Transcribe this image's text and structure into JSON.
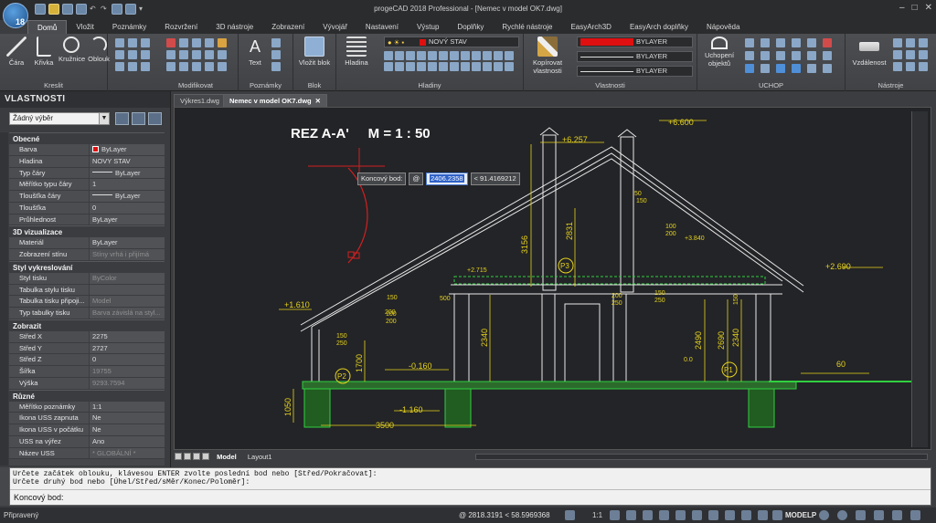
{
  "app": {
    "title": "progeCAD 2018 Professional - [Nemec v model OK7.dwg]",
    "logo_badge": "18"
  },
  "menu_tabs": [
    "Domů",
    "Vložit",
    "Poznámky",
    "Rozvržení",
    "3D nástroje",
    "Zobrazení",
    "Vývojář",
    "Nastavení",
    "Výstup",
    "Doplňky",
    "Rychlé nástroje",
    "EasyArch3D",
    "EasyArch doplňky",
    "Nápověda"
  ],
  "ribbon": {
    "draw": {
      "group": "Kreslit",
      "buttons": [
        "Čára",
        "Křivka",
        "Kružnice",
        "Oblouk"
      ]
    },
    "modify": {
      "group": "Modifikovat"
    },
    "annotation": {
      "group": "Poznámky",
      "buttons": [
        "Text"
      ]
    },
    "block": {
      "group": "Blok",
      "buttons": [
        "Vložit blok"
      ]
    },
    "layers": {
      "group": "Hladiny",
      "buttons": [
        "Hladina"
      ],
      "current_layer": "NOVÝ STAV"
    },
    "properties": {
      "group": "Vlastnosti",
      "buttons": [
        "Kopírovat vlastnosti"
      ],
      "color": "BYLAYER",
      "linetype": "BYLAYER",
      "lineweight": "BYLAYER",
      "color_hex": "#e01010"
    },
    "osnap": {
      "group": "UCHOP",
      "buttons": [
        "Uchopení objektů"
      ]
    },
    "tools": {
      "group": "Nástroje",
      "buttons": [
        "Vzdálenost"
      ]
    }
  },
  "properties_panel": {
    "title": "VLASTNOSTI",
    "selection": "Žádný výběr",
    "sections": [
      {
        "title": "Obecné",
        "rows": [
          {
            "key": "Barva",
            "value": "ByLayer",
            "kind": "swatch"
          },
          {
            "key": "Hladina",
            "value": "NOVY STAV"
          },
          {
            "key": "Typ čáry",
            "value": "ByLayer",
            "kind": "line"
          },
          {
            "key": "Měřítko typu čáry",
            "value": "1"
          },
          {
            "key": "Tloušťka čáry",
            "value": "ByLayer",
            "kind": "line"
          },
          {
            "key": "Tloušťka",
            "value": "0"
          },
          {
            "key": "Průhlednost",
            "value": "ByLayer"
          }
        ]
      },
      {
        "title": "3D vizualizace",
        "rows": [
          {
            "key": "Materiál",
            "value": "ByLayer"
          },
          {
            "key": "Zobrazení stínu",
            "value": "Stíny vrhá i přijímá",
            "dim": true
          }
        ]
      },
      {
        "title": "Styl vykreslování",
        "rows": [
          {
            "key": "Styl tisku",
            "value": "ByColor",
            "dim": true
          },
          {
            "key": "Tabulka stylu tisku",
            "value": ""
          },
          {
            "key": "Tabulka tisku připoji...",
            "value": "Model",
            "dim": true
          },
          {
            "key": "Typ tabulky tisku",
            "value": "Barva závislá na styl...",
            "dim": true
          }
        ]
      },
      {
        "title": "Zobrazit",
        "rows": [
          {
            "key": "Střed X",
            "value": "2275"
          },
          {
            "key": "Střed Y",
            "value": "2727"
          },
          {
            "key": "Střed Z",
            "value": "0"
          },
          {
            "key": "Šířka",
            "value": "19755",
            "dim": true
          },
          {
            "key": "Výška",
            "value": "9293.7594",
            "dim": true
          }
        ]
      },
      {
        "title": "Různé",
        "rows": [
          {
            "key": "Měřítko poznámky",
            "value": "1:1"
          },
          {
            "key": "Ikona USS zapnuta",
            "value": "Ne"
          },
          {
            "key": "Ikona USS v počátku",
            "value": "Ne"
          },
          {
            "key": "USS na výřez",
            "value": "Ano"
          },
          {
            "key": "Název USS",
            "value": "* GLOBÁLNÍ *",
            "dim": true
          }
        ]
      }
    ]
  },
  "doc_tabs": [
    "Výkres1.dwg",
    "Nemec v model OK7.dwg"
  ],
  "drawing": {
    "title": "REZ A-A'     M = 1 : 50",
    "levels": [
      "+6.600",
      "+6.257",
      "+2.690",
      "+2.715",
      "+3.840",
      "+1.610",
      "-0.160",
      "-1.160",
      "0.0"
    ],
    "dims": [
      "3156",
      "2831",
      "2490",
      "2690",
      "2340",
      "2340",
      "1700",
      "1050",
      "3500",
      "60",
      "50",
      "150",
      "100",
      "200",
      "150",
      "250",
      "150",
      "250",
      "200",
      "250",
      "150",
      "200",
      "150",
      "100",
      "200",
      "500"
    ],
    "markers": [
      "P3",
      "P2",
      "P1"
    ]
  },
  "dynamic_input": {
    "label": "Koncový bod:",
    "at": "@",
    "distance": "2406.2358",
    "angle": "< 91.4169212"
  },
  "layout_tabs": [
    "Model",
    "Layout1"
  ],
  "command": {
    "history": [
      "Určete začátek oblouku, klávesou ENTER zvolte poslední bod nebo [Střed/Pokračovat]:",
      "Určete druhý bod nebo [Úhel/Střed/sMěr/Konec/Poloměr]:"
    ],
    "prompt": "Koncový bod:"
  },
  "status": {
    "ready": "Připravený",
    "coords": "@ 2818.3191 < 58.5969368",
    "scale": "1:1",
    "model": "MODELP"
  }
}
